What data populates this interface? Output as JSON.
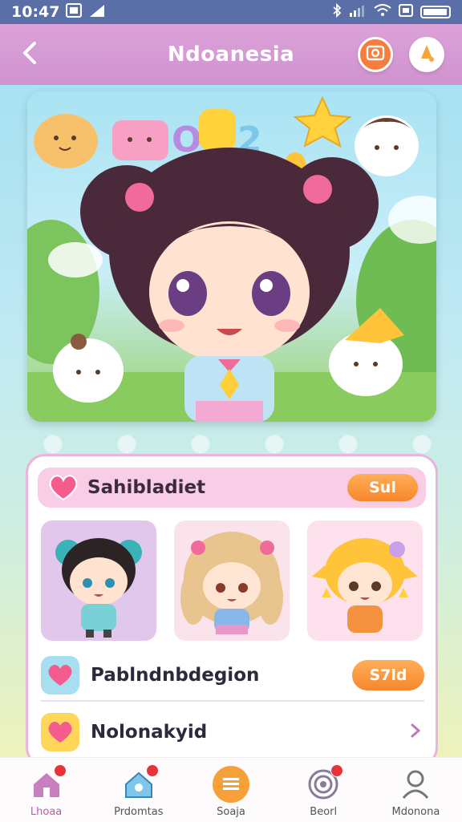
{
  "status_bar": {
    "time": "10:47"
  },
  "header": {
    "title": "Ndoanesia",
    "back_icon": "chevron-left-icon",
    "action1_icon": "photo-icon",
    "action2_icon": "bell-icon",
    "accent": "#f57e3e"
  },
  "hero": {
    "image": "cute-chibi-girl-illustration"
  },
  "section": {
    "title": "Sahibladiet",
    "button": "Sul",
    "tiles": [
      {
        "name": "chibi-boy-teal-buns"
      },
      {
        "name": "chibi-girl-blonde-curls"
      },
      {
        "name": "chibi-girl-yellow-hair"
      }
    ],
    "rows": [
      {
        "label": "Pablndnbdegion",
        "button": "S7ld"
      },
      {
        "label": "Nolonakyid"
      }
    ]
  },
  "nav": {
    "items": [
      {
        "label": "Lhoaa",
        "icon": "home-icon",
        "active": true
      },
      {
        "label": "Prdomtas",
        "icon": "house-icon"
      },
      {
        "label": "Soaja",
        "icon": "list-icon"
      },
      {
        "label": "Beorl",
        "icon": "target-icon"
      },
      {
        "label": "Mdonona",
        "icon": "user-icon"
      }
    ]
  }
}
